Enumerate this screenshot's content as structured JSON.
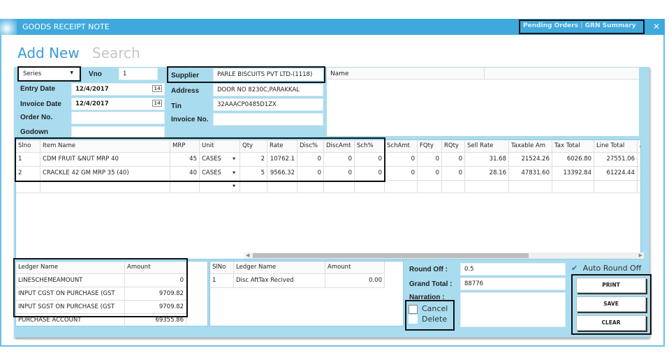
{
  "window": {
    "title": "GOODS RECEIPT NOTE",
    "links": [
      "Pending Orders",
      "GRN Summary"
    ],
    "close": "✕"
  },
  "modes": {
    "add": "Add New",
    "search": "Search"
  },
  "form": {
    "series": "Series",
    "vno_label": "Vno",
    "vno": "1",
    "entry_date_label": "Entry Date",
    "entry_date": "12/4/2017",
    "invoice_date_label": "Invoice Date",
    "invoice_date": "12/4/2017",
    "order_no_label": "Order No.",
    "order_no": "",
    "godown_label": "Godown",
    "godown": "",
    "supplier_label": "Supplier",
    "supplier": "PARLE BISCUITS PVT LTD-(1118)",
    "address_label": "Address",
    "address": "DOOR NO 8230C,PARAKKAL",
    "tin_label": "Tin",
    "tin": "32AAACP0485D1ZX",
    "invoice_no_label": "Invoice No.",
    "invoice_no": "",
    "calendar_day": "14"
  },
  "name_grid": {
    "header": "Name"
  },
  "items": {
    "columns": [
      "Slno",
      "Item Name",
      "MRP",
      "Unit",
      "Qty",
      "Rate",
      "Disc%",
      "DiscAmt",
      "Sch%",
      "SchAmt",
      "FQty",
      "RQty",
      "Sell Rate",
      "Taxable Am",
      "Tax Total",
      "Line Total",
      "A"
    ],
    "rows": [
      [
        "1",
        "CDM FRUIT &NUT MRP 40",
        "45",
        "CASES",
        "2",
        "10762.1",
        "0",
        "0",
        "0",
        "0",
        "0",
        "0",
        "31.68",
        "21524.26",
        "6026.80",
        "27551.06",
        ""
      ],
      [
        "2",
        "CRACKLE 42 GM MRP 35 (40)",
        "40",
        "CASES",
        "5",
        "9566.32",
        "0",
        "0",
        "0",
        "0",
        "0",
        "0",
        "28.16",
        "47831.60",
        "13392.84",
        "61224.44",
        ""
      ]
    ]
  },
  "ledger": {
    "columns": [
      "Ledger Name",
      "Amount"
    ],
    "rows": [
      [
        "LINESCHEMEAMOUNT",
        "0"
      ],
      [
        "INPUT CGST ON PURCHASE (GST",
        "9709.82"
      ],
      [
        "INPUT SGST ON PURCHASE (GST",
        "9709.82"
      ],
      [
        "PURCHASE ACCOUNT",
        "69355.86"
      ]
    ]
  },
  "ledger2": {
    "columns": [
      "SlNo",
      "Ledger Name",
      "Amount"
    ],
    "rows": [
      [
        "1",
        "Disc AftTax Recived",
        "0.00"
      ]
    ]
  },
  "totals": {
    "round_off_label": "Round Off :",
    "round_off": "0.5",
    "grand_total_label": "Grand Total :",
    "grand_total": "88776",
    "narration_label": "Narration :",
    "narration": "",
    "auto_round_off": "Auto Round Off",
    "auto_round_checked": true
  },
  "flags": {
    "cancel": "Cancel",
    "delete": "Delete"
  },
  "buttons": {
    "print": "PRINT",
    "save": "SAVE",
    "clear": "CLEAR"
  },
  "colors": {
    "titlebar": "#3fa9dd",
    "panel": "#a9dcef",
    "accent": "#3a9ad9"
  }
}
